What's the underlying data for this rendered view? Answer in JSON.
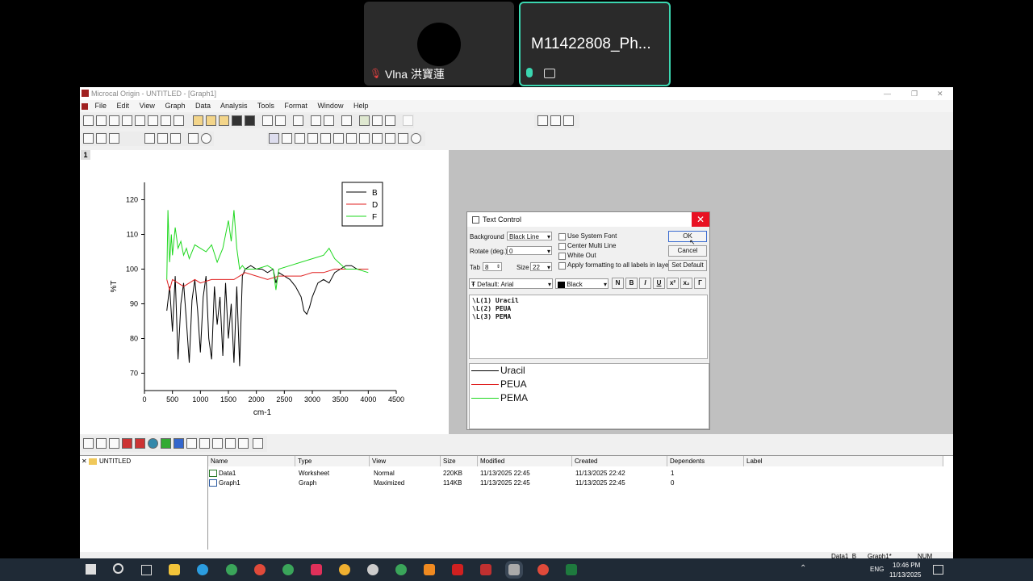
{
  "meeting": {
    "participant1": "Vlna 洪寶蓮",
    "participant2": "M11422808_Ph..."
  },
  "window": {
    "title": "Microcal Origin - UNTITLED - [Graph1]",
    "menu": [
      "File",
      "Edit",
      "View",
      "Graph",
      "Data",
      "Analysis",
      "Tools",
      "Format",
      "Window",
      "Help"
    ],
    "layer_tab": "1"
  },
  "chart_data": {
    "type": "line",
    "xlabel": "cm-1",
    "ylabel": "%T",
    "xlim": [
      0,
      4500
    ],
    "ylim": [
      65,
      125
    ],
    "x_ticks": [
      0,
      500,
      1000,
      1500,
      2000,
      2500,
      3000,
      3500,
      4000,
      4500
    ],
    "y_ticks": [
      70,
      80,
      90,
      100,
      110,
      120
    ],
    "legend": [
      "B",
      "D",
      "F"
    ],
    "legend_position": "top-right",
    "series": [
      {
        "name": "B",
        "color": "#000000",
        "x": [
          400,
          450,
          500,
          550,
          600,
          650,
          700,
          750,
          800,
          850,
          900,
          950,
          1000,
          1050,
          1100,
          1150,
          1200,
          1250,
          1300,
          1350,
          1400,
          1450,
          1500,
          1550,
          1600,
          1650,
          1700,
          1750,
          1800,
          1900,
          2000,
          2100,
          2200,
          2300,
          2350,
          2400,
          2500,
          2600,
          2700,
          2800,
          2850,
          2900,
          2950,
          3000,
          3100,
          3200,
          3300,
          3400,
          3500,
          3600,
          3700,
          3800,
          3900,
          4000
        ],
        "y": [
          88,
          95,
          82,
          98,
          74,
          90,
          96,
          85,
          73,
          91,
          97,
          88,
          76,
          92,
          98,
          80,
          74,
          95,
          84,
          92,
          75,
          96,
          80,
          90,
          73,
          95,
          72,
          98,
          100,
          101,
          100,
          100,
          99,
          100,
          96,
          99,
          98,
          97,
          95,
          92,
          88,
          87,
          89,
          92,
          96,
          97,
          96,
          99,
          100,
          101,
          101,
          100,
          100,
          100
        ]
      },
      {
        "name": "D",
        "color": "#e02020",
        "x": [
          400,
          450,
          500,
          600,
          700,
          800,
          900,
          1000,
          1200,
          1400,
          1600,
          1700,
          1800,
          2000,
          2200,
          2400,
          2600,
          2800,
          3000,
          3200,
          3400,
          3600,
          3800,
          4000
        ],
        "y": [
          97,
          94,
          97,
          96,
          95,
          96,
          97,
          96,
          97,
          97,
          97,
          98,
          99,
          98,
          97,
          98,
          98,
          98,
          99,
          99,
          100,
          100,
          100,
          100
        ]
      },
      {
        "name": "F",
        "color": "#1fd81f",
        "x": [
          400,
          420,
          450,
          480,
          500,
          550,
          600,
          650,
          700,
          750,
          800,
          900,
          1000,
          1100,
          1200,
          1300,
          1400,
          1500,
          1550,
          1600,
          1650,
          1700,
          1750,
          1800,
          2000,
          2200,
          2300,
          2350,
          2400,
          2600,
          2800,
          3000,
          3200,
          3300,
          3400,
          3600,
          3800,
          4000
        ],
        "y": [
          97,
          117,
          102,
          110,
          104,
          112,
          106,
          108,
          104,
          106,
          103,
          107,
          106,
          105,
          107,
          102,
          106,
          114,
          108,
          117,
          106,
          100,
          101,
          100,
          100,
          101,
          100,
          94,
          100,
          101,
          102,
          103,
          104,
          106,
          103,
          100,
          100,
          99
        ]
      }
    ]
  },
  "dialog": {
    "title": "Text Control",
    "close_glyph": "✕",
    "background_label": "Background",
    "background_value": "Black Line",
    "rotate_label": "Rotate (deg.)",
    "rotate_value": "0",
    "tab_label": "Tab",
    "tab_value": "8",
    "size_label": "Size",
    "size_value": "22",
    "checkboxes": [
      "Use System Font",
      "Center Multi Line",
      "White Out",
      "Apply formatting to all labels in layer"
    ],
    "ok": "OK",
    "cancel": "Cancel",
    "set_default": "Set Default",
    "font_value": "Default: Arial",
    "color_value": "Black",
    "format_buttons": [
      "N",
      "B",
      "I",
      "U",
      "x²",
      "x₂",
      "Γ"
    ],
    "code_lines": [
      "\\L(1) Uracil",
      "\\L(2) PEUA",
      "\\L(3) PEMA"
    ],
    "preview": [
      {
        "label": "Uracil",
        "color": "#000000"
      },
      {
        "label": "PEUA",
        "color": "#e02020"
      },
      {
        "label": "PEMA",
        "color": "#1fd81f"
      }
    ]
  },
  "explorer": {
    "root": "UNTITLED",
    "headers": [
      "Name",
      "Type",
      "View",
      "Size",
      "Modified",
      "Created",
      "Dependents",
      "Label"
    ],
    "rows": [
      {
        "name": "Data1",
        "type": "Worksheet",
        "view": "Normal",
        "size": "220KB",
        "modified": "11/13/2025 22:45",
        "created": "11/13/2025 22:42",
        "dependents": "1"
      },
      {
        "name": "Graph1",
        "type": "Graph",
        "view": "Maximized",
        "size": "114KB",
        "modified": "11/13/2025 22:45",
        "created": "11/13/2025 22:45",
        "dependents": "0"
      }
    ]
  },
  "status": {
    "cell1": "Data1_B",
    "cell2": "Graph1*",
    "cell3": "NUM"
  },
  "taskbar": {
    "lang": "ENG",
    "time": "10:46 PM",
    "date": "11/13/2025"
  }
}
